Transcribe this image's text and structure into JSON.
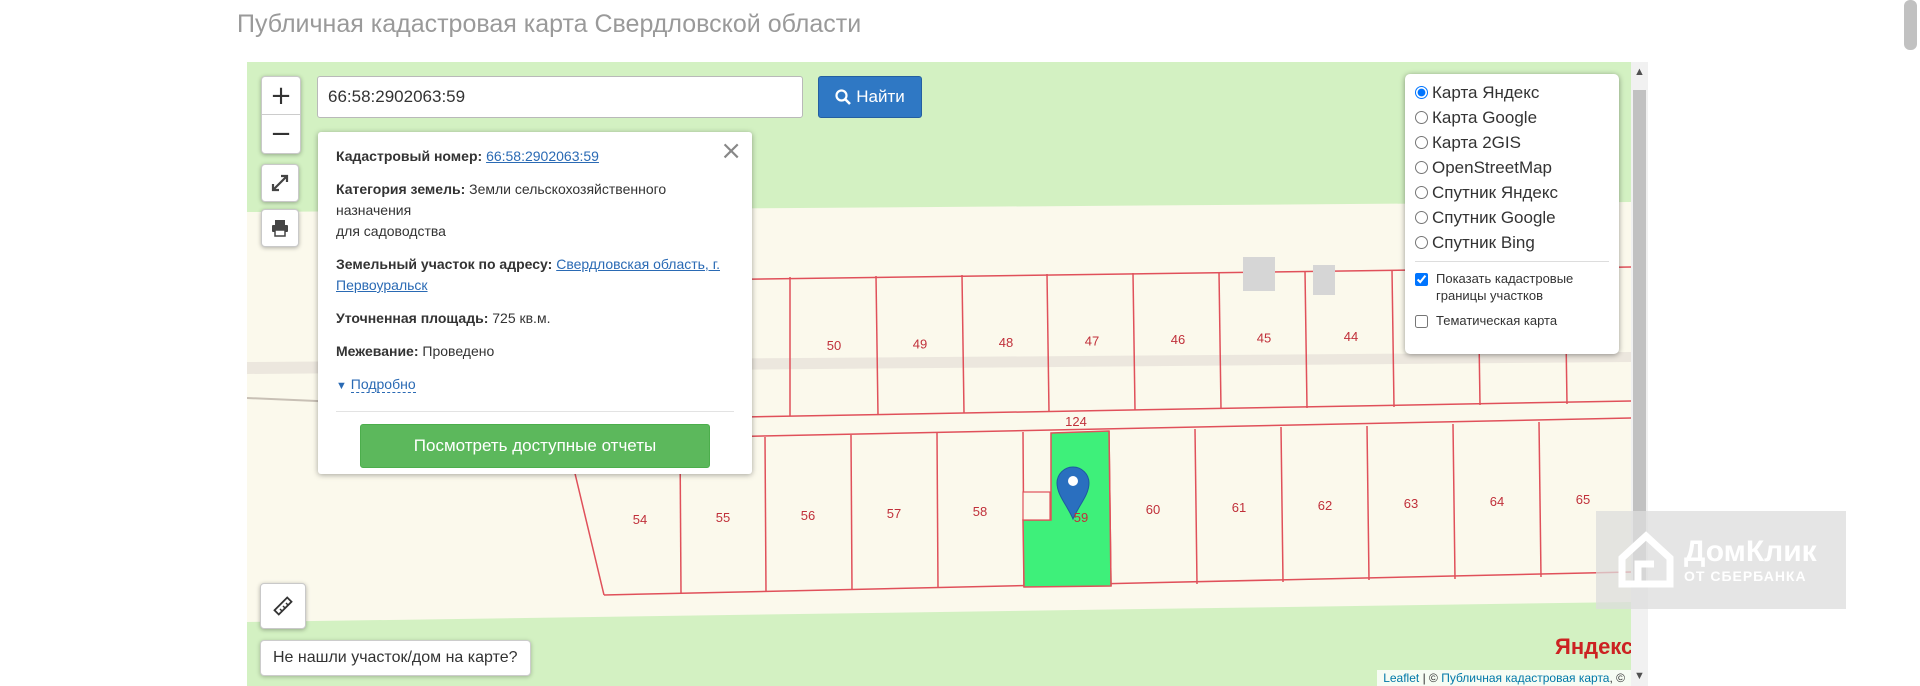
{
  "page": {
    "title": "Публичная кадастровая карта Свердловской области"
  },
  "search": {
    "value": "66:58:2902063:59",
    "button_label": "Найти"
  },
  "zoom": {
    "in_label": "+",
    "out_label": "−"
  },
  "popup": {
    "cadastral_label": "Кадастровый номер:",
    "cadastral_value": "66:58:2902063:59",
    "category_label": "Категория земель:",
    "category_value": "Земли сельскохозяйственного назначения",
    "category_use": "для садоводства",
    "address_label": "Земельный участок по адресу:",
    "address_value": "Свердловская область, г. Первоуральск",
    "area_label": "Уточненная площадь:",
    "area_value": "725 кв.м.",
    "survey_label": "Межевание:",
    "survey_value": "Проведено",
    "more_label": "Подробно",
    "report_button": "Посмотреть доступные отчеты",
    "close": "×"
  },
  "layers": {
    "options": [
      "Карта Яндекс",
      "Карта Google",
      "Карта 2GIS",
      "OpenStreetMap",
      "Спутник Яндекс",
      "Спутник Google",
      "Спутник Bing"
    ],
    "selected": "Карта Яндекс",
    "show_borders": "Показать кадастровые границы участков",
    "thematic": "Тематическая карта"
  },
  "parcels": {
    "top": [
      "50",
      "49",
      "48",
      "47",
      "46",
      "45",
      "44"
    ],
    "road": "124",
    "bottom": [
      "54",
      "55",
      "56",
      "57",
      "58",
      "60",
      "61",
      "62",
      "63",
      "64",
      "65"
    ],
    "selected_label": "59"
  },
  "not_found": "Не нашли участок/дом на карте?",
  "attribution": {
    "leaflet": "Leaflet",
    "sep": " | © ",
    "source": "Публичная кадастровая карта",
    "tail": ", ©"
  },
  "yandex_logo": "Яндекс",
  "watermark": {
    "brand": "ДомКлик",
    "sub": "ОТ СБЕРБАНКА"
  },
  "colors": {
    "map_green": "#d3f1c2",
    "parcel_line": "#e0505a",
    "selected_parcel": "#3ef07a",
    "search_button": "#2f78c4",
    "report_button": "#5cb85c"
  }
}
